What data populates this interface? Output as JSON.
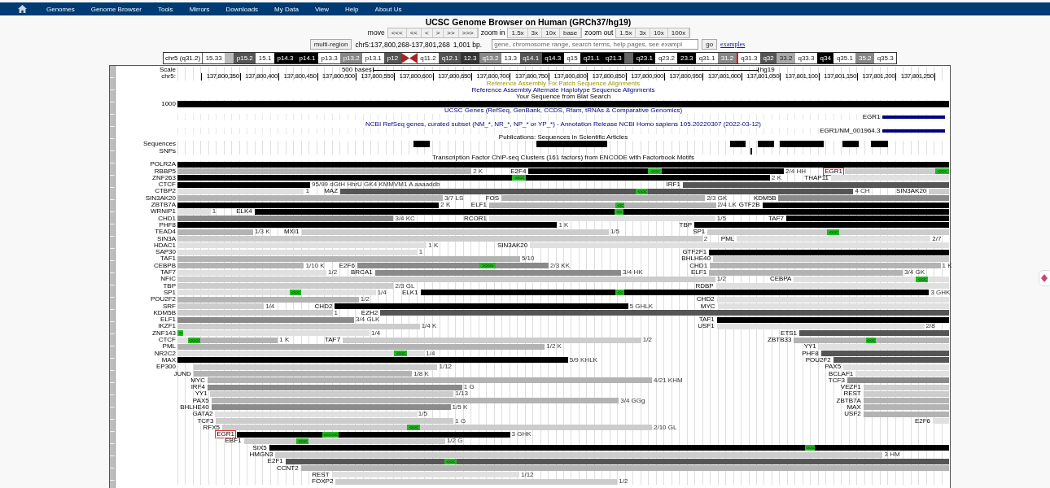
{
  "nav": {
    "items": [
      "Genomes",
      "Genome Browser",
      "Tools",
      "Mirrors",
      "Downloads",
      "My Data",
      "View",
      "Help",
      "About Us"
    ]
  },
  "title": "UCSC Genome Browser on Human (GRCh37/hg19)",
  "controls": {
    "move_label": "move",
    "move_buttons": [
      "<<<",
      "<<",
      "<",
      ">",
      ">>",
      ">>>"
    ],
    "zoom_in_label": "zoom in",
    "zoom_in_buttons": [
      "1.5x",
      "3x",
      "10x",
      "base"
    ],
    "zoom_out_label": "zoom out",
    "zoom_out_buttons": [
      "1.5x",
      "3x",
      "10x",
      "100x"
    ]
  },
  "position": {
    "multi_region": "multi-region",
    "range": "chr5:137,800,268-137,801,268",
    "size": "1,001 bp.",
    "placeholder": "gene, chromosome range, search terms, help pages, see exampl",
    "go": "go",
    "examples": "examples"
  },
  "ideogram": {
    "label": "chr5 (q31.2)",
    "bands": [
      {
        "kind": "band",
        "label": "15.33",
        "color": "#ffffff"
      },
      {
        "kind": "band",
        "color": "#bbbbbb"
      },
      {
        "kind": "band",
        "label": "p15.2",
        "color": "#555555"
      },
      {
        "kind": "band",
        "label": "15.1",
        "color": "#ffffff"
      },
      {
        "kind": "band",
        "label": "p14.3",
        "color": "#000000"
      },
      {
        "kind": "band",
        "label": "p14.1",
        "color": "#000000"
      },
      {
        "kind": "band",
        "label": "p13.3",
        "color": "#ffffff"
      },
      {
        "kind": "band",
        "label": "p13.2",
        "color": "#888888"
      },
      {
        "kind": "band",
        "label": "p13.1",
        "color": "#ffffff"
      },
      {
        "kind": "band",
        "label": "p12",
        "color": "#555555"
      },
      {
        "kind": "centromere",
        "color": "#aa2222"
      },
      {
        "kind": "band",
        "label": "q11.2",
        "color": "#ffffff"
      },
      {
        "kind": "band",
        "label": "q12.1",
        "color": "#555555"
      },
      {
        "kind": "band",
        "label": "12.3",
        "color": "#333333"
      },
      {
        "kind": "band",
        "label": "q13.2",
        "color": "#888888"
      },
      {
        "kind": "band",
        "label": "13.3",
        "color": "#ffffff"
      },
      {
        "kind": "band",
        "label": "q14.1",
        "color": "#555555"
      },
      {
        "kind": "band",
        "label": "q14.3",
        "color": "#000000"
      },
      {
        "kind": "band",
        "label": "q15",
        "color": "#ffffff"
      },
      {
        "kind": "band",
        "label": "q21.1",
        "color": "#000000"
      },
      {
        "kind": "band",
        "label": "q21.3",
        "color": "#000000"
      },
      {
        "kind": "band",
        "color": "#666666"
      },
      {
        "kind": "band",
        "label": "q23.1",
        "color": "#000000"
      },
      {
        "kind": "band",
        "label": "q23.2",
        "color": "#ffffff"
      },
      {
        "kind": "band",
        "label": "23.3",
        "color": "#000000"
      },
      {
        "kind": "band",
        "label": "q31.1",
        "color": "#ffffff"
      },
      {
        "kind": "band",
        "label": "31.2",
        "color": "#888888"
      },
      {
        "kind": "marker",
        "color": "#ee0000"
      },
      {
        "kind": "band",
        "label": "q31.3",
        "color": "#ffffff"
      },
      {
        "kind": "band",
        "label": "q32",
        "color": "#555555"
      },
      {
        "kind": "band",
        "label": "33.2",
        "color": "#aaaaaa"
      },
      {
        "kind": "band",
        "label": "q33.3",
        "color": "#ffffff"
      },
      {
        "kind": "band",
        "label": "q34",
        "color": "#000000"
      },
      {
        "kind": "band",
        "label": "q35.1",
        "color": "#ffffff"
      },
      {
        "kind": "band",
        "label": "35.2",
        "color": "#888888"
      },
      {
        "kind": "band",
        "label": "q35.3",
        "color": "#ffffff"
      }
    ]
  },
  "tracks": [
    {
      "kind": "scale",
      "label": "Scale",
      "scale_text": "500 bases",
      "assembly": "hg19"
    },
    {
      "kind": "ruler",
      "label": "chr5:",
      "ticks": [
        "137,800,350",
        "137,800,400",
        "137,800,450",
        "137,800,500",
        "137,800,550",
        "137,800,600",
        "137,800,650",
        "137,800,700",
        "137,800,750",
        "137,800,800",
        "137,800,850",
        "137,800,900",
        "137,800,950",
        "137,801,000",
        "137,801,050",
        "137,801,100",
        "137,801,150",
        "137,801,200",
        "137,801,250"
      ]
    },
    {
      "kind": "olivetitle",
      "text": "Reference Assembly Fix Patch Sequence Alignments"
    },
    {
      "kind": "navytitle",
      "text": "Reference Assembly Alternate Haplotype Sequence Alignments"
    },
    {
      "kind": "title",
      "text": "Your Sequence from Blat Search"
    },
    {
      "kind": "blocks",
      "label": "1000",
      "segments": [
        {
          "kind": "bar",
          "color": "#000000"
        }
      ]
    },
    {
      "kind": "navytitle",
      "text": "UCSC Genes (RefSeq, GenBank, CCDS, Rfam, tRNAs & Comparative Genomics)"
    },
    {
      "kind": "gene",
      "segments": [
        {
          "kind": "gap"
        },
        {
          "kind": "gene",
          "color": "#000080",
          "name": "EGR1"
        }
      ]
    },
    {
      "kind": "navytitle",
      "text": "NCBI RefSeq genes, curated subset (NM_*, NR_*, NP_* or YP_*) - Annotation Release NCBI Homo sapiens 105.20220307 (2022-03-12)"
    },
    {
      "kind": "gene",
      "segments": [
        {
          "kind": "gap"
        },
        {
          "kind": "gene",
          "color": "#000080",
          "name": "EGR1/NM_001964.3"
        }
      ]
    },
    {
      "kind": "title",
      "text": "Publications: Sequences in Scientific Articles"
    },
    {
      "kind": "blocks",
      "label": "Sequences",
      "segments": [
        {
          "kind": "gap"
        },
        {
          "kind": "bar",
          "color": "#000000"
        },
        {
          "kind": "gap"
        },
        {
          "kind": "bar",
          "color": "#000000"
        },
        {
          "kind": "gap"
        },
        {
          "kind": "bar",
          "color": "#000000"
        },
        {
          "kind": "gap"
        },
        {
          "kind": "bar",
          "color": "#000000"
        },
        {
          "kind": "gap"
        },
        {
          "kind": "bar",
          "color": "#000000"
        },
        {
          "kind": "gap"
        },
        {
          "kind": "bar",
          "color": "#000000"
        },
        {
          "kind": "gap"
        },
        {
          "kind": "bar",
          "color": "#000000"
        }
      ]
    },
    {
      "kind": "blocks",
      "label": "SNPs",
      "segments": [
        {
          "kind": "gap"
        },
        {
          "kind": "bar",
          "color": "#000000"
        }
      ]
    },
    {
      "kind": "title",
      "text": "Transcription Factor ChIP-seq Clusters (161 factors) from ENCODE with Factorbook Motifs"
    },
    {
      "kind": "tf",
      "label": "POLR2A",
      "segments": [
        {
          "kind": "bar",
          "color": "#000000"
        }
      ]
    },
    {
      "kind": "tf",
      "label": "RBBP5",
      "segments": [
        {
          "kind": "bar",
          "color": "#b3b3b3",
          "score": "2 K"
        },
        {
          "kind": "gap"
        },
        {
          "kind": "bar",
          "color": "#000000",
          "name": "E2F4"
        },
        {
          "kind": "motif",
          "text": "<<<"
        },
        {
          "kind": "bar",
          "color": "#000000",
          "score": "2/4 HH"
        },
        {
          "kind": "gap"
        },
        {
          "kind": "bar",
          "color": "#cccccc",
          "name": "EGR1",
          "boxed": true
        },
        {
          "kind": "motif",
          "text": "<<<"
        }
      ]
    },
    {
      "kind": "tf",
      "label": "ZNF263",
      "segments": [
        {
          "kind": "bar",
          "color": "#000000"
        },
        {
          "kind": "motif",
          "text": "<<<"
        },
        {
          "kind": "bar",
          "color": "#000000",
          "score": "2 K"
        },
        {
          "kind": "gap"
        },
        {
          "kind": "bar",
          "color": "#e0e0e0",
          "name": "THAP11"
        }
      ]
    },
    {
      "kind": "tf",
      "label": "CTCF",
      "segments": [
        {
          "kind": "bar",
          "color": "#000000",
          "score": "95/99 dGtH HhrU GK4 KMMVM1 A aaaaddb"
        },
        {
          "kind": "gap"
        },
        {
          "kind": "bar",
          "color": "#555555",
          "name": "IRF1"
        }
      ]
    },
    {
      "kind": "tf",
      "label": "CTBP2",
      "segments": [
        {
          "kind": "bar",
          "color": "#e0e0e0",
          "score": "1"
        },
        {
          "kind": "gap"
        },
        {
          "kind": "bar",
          "color": "#555555",
          "name": "MAZ"
        },
        {
          "kind": "motif",
          "text": "<<<"
        },
        {
          "kind": "bar",
          "color": "#555555",
          "score": "4 CH"
        },
        {
          "kind": "gap"
        },
        {
          "kind": "bar",
          "color": "#cccccc",
          "name": "SIN3AK20"
        }
      ]
    },
    {
      "kind": "tf",
      "label": "SIN3AK20",
      "segments": [
        {
          "kind": "bar",
          "color": "#b3b3b3",
          "score": "3/7 LS"
        },
        {
          "kind": "gap"
        },
        {
          "kind": "bar",
          "color": "#b3b3b3",
          "name": "FOS",
          "score": "2/3 GK"
        },
        {
          "kind": "gap"
        },
        {
          "kind": "bar",
          "color": "#8a8a8a",
          "name": "KDM5B"
        }
      ]
    },
    {
      "kind": "tf",
      "label": "ZBTB7A",
      "segments": [
        {
          "kind": "bar",
          "color": "#000000",
          "score": "2 K"
        },
        {
          "kind": "gap"
        },
        {
          "kind": "bar",
          "color": "#b3b3b3",
          "name": "ELF1"
        },
        {
          "kind": "motif",
          "text": "<<"
        },
        {
          "kind": "bar",
          "color": "#b3b3b3",
          "score": "2/4 LK"
        },
        {
          "kind": "gap"
        },
        {
          "kind": "bar",
          "color": "#000000",
          "name": "GTF2B"
        }
      ]
    },
    {
      "kind": "tf",
      "label": "WRNIP1",
      "segments": [
        {
          "kind": "bar",
          "color": "#e0e0e0",
          "score": "1"
        },
        {
          "kind": "gap"
        },
        {
          "kind": "bar",
          "color": "#000000",
          "name": "ELK4"
        },
        {
          "kind": "motif",
          "text": "<<"
        },
        {
          "kind": "bar",
          "color": "#000000"
        }
      ]
    },
    {
      "kind": "tf",
      "label": "CHD1",
      "segments": [
        {
          "kind": "bar",
          "color": "#8a8a8a",
          "score": "3/4 KC"
        },
        {
          "kind": "gap"
        },
        {
          "kind": "bar",
          "color": "#e0e0e0",
          "name": "RCOR1",
          "score": "1/5"
        },
        {
          "kind": "gap"
        },
        {
          "kind": "bar",
          "color": "#000000",
          "name": "TAF7"
        }
      ]
    },
    {
      "kind": "tf",
      "label": "PHF8",
      "segments": [
        {
          "kind": "bar",
          "color": "#000000",
          "score": "1 K"
        },
        {
          "kind": "gap"
        },
        {
          "kind": "bar",
          "color": "#000000",
          "name": "TBP"
        }
      ]
    },
    {
      "kind": "tf",
      "label": "TEAD4",
      "segments": [
        {
          "kind": "bar",
          "color": "#b3b3b3",
          "score": "1/3 K"
        },
        {
          "kind": "gap"
        },
        {
          "kind": "bar",
          "color": "#cccccc",
          "name": "MXI1",
          "score": "1/5"
        },
        {
          "kind": "gap"
        },
        {
          "kind": "bar",
          "color": "#cccccc",
          "name": "SP1"
        },
        {
          "kind": "motif",
          "text": "<<<"
        },
        {
          "kind": "bar",
          "color": "#cccccc"
        }
      ]
    },
    {
      "kind": "tf",
      "label": "SIN3A",
      "segments": [
        {
          "kind": "bar",
          "color": "#cccccc",
          "score": "2"
        },
        {
          "kind": "gap"
        },
        {
          "kind": "bar",
          "color": "#e0e0e0",
          "name": "PML",
          "score": "2/7"
        },
        {
          "kind": "gap"
        }
      ]
    },
    {
      "kind": "tf",
      "label": "HDAC1",
      "segments": [
        {
          "kind": "bar",
          "color": "#e0e0e0",
          "score": "1 K"
        },
        {
          "kind": "gap"
        },
        {
          "kind": "bar",
          "color": "#e0e0e0",
          "name": "SIN3AK20"
        }
      ]
    },
    {
      "kind": "tf",
      "label": "SAP30",
      "segments": [
        {
          "kind": "bar",
          "color": "#e0e0e0",
          "score": "1"
        },
        {
          "kind": "gap"
        },
        {
          "kind": "bar",
          "color": "#000000",
          "name": "GTF2F1"
        }
      ]
    },
    {
      "kind": "tf",
      "label": "TAF1",
      "segments": [
        {
          "kind": "bar",
          "color": "#b3b3b3",
          "score": "5/10"
        },
        {
          "kind": "gap"
        },
        {
          "kind": "bar",
          "color": "#cccccc",
          "name": "BHLHE40"
        }
      ]
    },
    {
      "kind": "tf",
      "label": "CEBPB",
      "segments": [
        {
          "kind": "bar",
          "color": "#b3b3b3",
          "score": "1/10 K"
        },
        {
          "kind": "gap"
        },
        {
          "kind": "bar",
          "color": "#8a8a8a",
          "name": "E2F6"
        },
        {
          "kind": "motif",
          "text": ">>>>"
        },
        {
          "kind": "bar",
          "color": "#8a8a8a",
          "score": "2/3 KK"
        },
        {
          "kind": "gap"
        },
        {
          "kind": "bar",
          "color": "#b3b3b3",
          "name": "CHD1",
          "score": "1 K"
        },
        {
          "kind": "gap"
        }
      ]
    },
    {
      "kind": "tf",
      "label": "TAF7",
      "segments": [
        {
          "kind": "bar",
          "color": "#e0e0e0",
          "score": "1/2"
        },
        {
          "kind": "gap"
        },
        {
          "kind": "bar",
          "color": "#8a8a8a",
          "name": "BRCA1",
          "score": "3/4 HK"
        },
        {
          "kind": "gap"
        },
        {
          "kind": "bar",
          "color": "#b3b3b3",
          "name": "ELF1",
          "score": "3/4 GK"
        },
        {
          "kind": "gap"
        }
      ]
    },
    {
      "kind": "tf",
      "label": "NFIC",
      "segments": [
        {
          "kind": "bar",
          "color": "#cccccc",
          "score": "1/2"
        },
        {
          "kind": "gap"
        },
        {
          "kind": "bar",
          "color": "#e0e0e0",
          "name": "CEBPA"
        },
        {
          "kind": "motif",
          "text": "<<<"
        },
        {
          "kind": "bar",
          "color": "#e0e0e0"
        }
      ]
    },
    {
      "kind": "tf",
      "label": "TBP",
      "segments": [
        {
          "kind": "bar",
          "color": "#cccccc",
          "score": "2/3 GL"
        },
        {
          "kind": "gap"
        },
        {
          "kind": "bar",
          "color": "#e0e0e0",
          "name": "RDBP"
        }
      ]
    },
    {
      "kind": "tf",
      "label": "SP1",
      "segments": [
        {
          "kind": "bar",
          "color": "#e0e0e0"
        },
        {
          "kind": "motif",
          "text": "<<<"
        },
        {
          "kind": "bar",
          "color": "#e0e0e0",
          "score": "1/4"
        },
        {
          "kind": "gap"
        },
        {
          "kind": "bar",
          "color": "#000000",
          "name": "ELK1"
        },
        {
          "kind": "motif",
          "text": "<<"
        },
        {
          "kind": "bar",
          "color": "#000000",
          "score": "3 GHK"
        },
        {
          "kind": "gap"
        }
      ]
    },
    {
      "kind": "tf",
      "label": "POU2F2",
      "segments": [
        {
          "kind": "bar",
          "color": "#b3b3b3",
          "score": "1/2"
        },
        {
          "kind": "gap"
        },
        {
          "kind": "bar",
          "color": "#e0e0e0",
          "name": "CHD2"
        }
      ]
    },
    {
      "kind": "tf",
      "label": "SRF",
      "segments": [
        {
          "kind": "bar",
          "color": "#cccccc",
          "score": "1/4"
        },
        {
          "kind": "gap"
        },
        {
          "kind": "bar",
          "color": "#000000",
          "name": "CHD2",
          "score": "5 GHLK"
        },
        {
          "kind": "gap"
        },
        {
          "kind": "bar",
          "color": "#e0e0e0",
          "name": "MYC"
        }
      ]
    },
    {
      "kind": "tf",
      "label": "KDM5B",
      "segments": [
        {
          "kind": "bar",
          "color": "#cccccc",
          "score": "1"
        },
        {
          "kind": "gap"
        },
        {
          "kind": "bar",
          "color": "#555555",
          "name": "EZH2"
        }
      ]
    },
    {
      "kind": "tf",
      "label": "ELF1",
      "segments": [
        {
          "kind": "bar",
          "color": "#8a8a8a",
          "score": "3/4 GLK"
        },
        {
          "kind": "gap"
        },
        {
          "kind": "bar",
          "color": "#000000",
          "name": "TAF1"
        }
      ]
    },
    {
      "kind": "tf",
      "label": "IKZF1",
      "segments": [
        {
          "kind": "bar",
          "color": "#cccccc",
          "score": "1/4 K"
        },
        {
          "kind": "gap"
        },
        {
          "kind": "bar",
          "color": "#e0e0e0",
          "name": "USF1",
          "score": "2/8"
        },
        {
          "kind": "gap"
        }
      ]
    },
    {
      "kind": "tf",
      "label": "ZNF143",
      "segments": [
        {
          "kind": "motif",
          "text": ">"
        },
        {
          "kind": "bar",
          "color": "#e0e0e0",
          "score": "1/4"
        },
        {
          "kind": "gap"
        },
        {
          "kind": "bar",
          "color": "#555555",
          "name": "ETS1"
        }
      ]
    },
    {
      "kind": "tf",
      "label": "CTCF",
      "segments": [
        {
          "kind": "bar",
          "color": "#e0e0e0"
        },
        {
          "kind": "motif",
          "text": "<<<<"
        },
        {
          "kind": "bar",
          "color": "#b3b3b3",
          "score": "1 K"
        },
        {
          "kind": "gap"
        },
        {
          "kind": "bar",
          "color": "#cccccc",
          "name": "TAF7",
          "score": "1/2"
        },
        {
          "kind": "gap"
        },
        {
          "kind": "bar",
          "color": "#b3b3b3",
          "name": "ZBTB33"
        },
        {
          "kind": "motif",
          "text": "<<<"
        },
        {
          "kind": "bar",
          "color": "#b3b3b3"
        }
      ]
    },
    {
      "kind": "tf",
      "label": "PML",
      "segments": [
        {
          "kind": "bar",
          "color": "#b3b3b3",
          "score": "1/2 K"
        },
        {
          "kind": "gap"
        },
        {
          "kind": "bar",
          "color": "#e0e0e0",
          "name": "YY1"
        }
      ]
    },
    {
      "kind": "tf",
      "label": "NR2C2",
      "segments": [
        {
          "kind": "bar",
          "color": "#e0e0e0"
        },
        {
          "kind": "motif",
          "text": "<<<"
        },
        {
          "kind": "bar",
          "color": "#e0e0e0",
          "score": "1/4"
        },
        {
          "kind": "gap"
        },
        {
          "kind": "bar",
          "color": "#555555",
          "name": "PHF8"
        }
      ]
    },
    {
      "kind": "tf",
      "label": "MAX",
      "segments": [
        {
          "kind": "bar",
          "color": "#000000",
          "score": "5/9 KHLK"
        },
        {
          "kind": "gap"
        },
        {
          "kind": "bar",
          "color": "#555555",
          "name": "POU2F2"
        }
      ]
    },
    {
      "kind": "tf",
      "label": "EP300",
      "segments": [
        {
          "kind": "gap"
        },
        {
          "kind": "bar",
          "color": "#cccccc",
          "score": "1/12"
        },
        {
          "kind": "gap"
        },
        {
          "kind": "bar",
          "color": "#e0e0e0",
          "name": "PAX5"
        }
      ]
    },
    {
      "kind": "tf",
      "segments": [
        {
          "kind": "gap"
        },
        {
          "kind": "bar",
          "color": "#b3b3b3",
          "name": "JUND",
          "score": "1/8 K"
        },
        {
          "kind": "gap"
        },
        {
          "kind": "bar",
          "color": "#e0e0e0",
          "name": "BCLAF1"
        }
      ]
    },
    {
      "kind": "tf",
      "segments": [
        {
          "kind": "gap"
        },
        {
          "kind": "bar",
          "color": "#b3b3b3",
          "name": "MYC",
          "score": "4/21 KHM"
        },
        {
          "kind": "gap"
        },
        {
          "kind": "bar",
          "color": "#8a8a8a",
          "name": "TCF3"
        }
      ]
    },
    {
      "kind": "tf",
      "segments": [
        {
          "kind": "gap"
        },
        {
          "kind": "bar",
          "color": "#8a8a8a",
          "name": "IRF4",
          "score": "1 G"
        },
        {
          "kind": "gap"
        },
        {
          "kind": "bar",
          "color": "#cccccc",
          "name": "VEZF1"
        }
      ]
    },
    {
      "kind": "tf",
      "segments": [
        {
          "kind": "gap"
        },
        {
          "kind": "bar",
          "color": "#cccccc",
          "name": "YY1",
          "score": "1/13"
        },
        {
          "kind": "gap"
        },
        {
          "kind": "bar",
          "color": "#cccccc",
          "name": "REST"
        }
      ]
    },
    {
      "kind": "tf",
      "segments": [
        {
          "kind": "gap"
        },
        {
          "kind": "bar",
          "color": "#b3b3b3",
          "name": "PAX5",
          "score": "3/4 GGg"
        },
        {
          "kind": "gap"
        },
        {
          "kind": "bar",
          "color": "#b3b3b3",
          "name": "ZBTB7A"
        }
      ]
    },
    {
      "kind": "tf",
      "segments": [
        {
          "kind": "gap"
        },
        {
          "kind": "bar",
          "color": "#8a8a8a",
          "name": "BHLHE40",
          "score": "1/5 K"
        },
        {
          "kind": "gap"
        },
        {
          "kind": "bar",
          "color": "#b3b3b3",
          "name": "MAX"
        }
      ]
    },
    {
      "kind": "tf",
      "segments": [
        {
          "kind": "gap"
        },
        {
          "kind": "bar",
          "color": "#e0e0e0",
          "name": "GATA2",
          "score": "1/5"
        },
        {
          "kind": "gap"
        },
        {
          "kind": "bar",
          "color": "#b3b3b3",
          "name": "USF2"
        }
      ]
    },
    {
      "kind": "tf",
      "segments": [
        {
          "kind": "gap"
        },
        {
          "kind": "bar",
          "color": "#cccccc",
          "name": "TCF3",
          "score": "1 G"
        },
        {
          "kind": "gap"
        },
        {
          "kind": "bar",
          "color": "#e0e0e0",
          "name": "E2F6"
        }
      ]
    },
    {
      "kind": "tf",
      "segments": [
        {
          "kind": "gap"
        },
        {
          "kind": "bar",
          "color": "#cccccc",
          "name": "RFX5"
        },
        {
          "kind": "motif",
          "text": "<<<"
        },
        {
          "kind": "bar",
          "color": "#cccccc",
          "score": "2/10 GL"
        },
        {
          "kind": "gap"
        }
      ]
    },
    {
      "kind": "tf",
      "segments": [
        {
          "kind": "gap"
        },
        {
          "kind": "bar",
          "color": "#000000",
          "name": "EGR1",
          "boxed": true
        },
        {
          "kind": "motif",
          "text": "<<<<<"
        },
        {
          "kind": "bar",
          "color": "#000000",
          "score": "3 GHK"
        },
        {
          "kind": "gap"
        }
      ]
    },
    {
      "kind": "tf",
      "segments": [
        {
          "kind": "gap"
        },
        {
          "kind": "bar",
          "color": "#cccccc",
          "name": "EBF1"
        },
        {
          "kind": "motif",
          "text": "<<<"
        },
        {
          "kind": "bar",
          "color": "#cccccc",
          "score": "1/2 G"
        },
        {
          "kind": "gap"
        }
      ]
    },
    {
      "kind": "tf",
      "segments": [
        {
          "kind": "gap"
        },
        {
          "kind": "bar",
          "color": "#000000",
          "name": "SIX5"
        },
        {
          "kind": "motif",
          "text": "<<<"
        },
        {
          "kind": "bar",
          "color": "#000000"
        }
      ]
    },
    {
      "kind": "tf",
      "segments": [
        {
          "kind": "gap"
        },
        {
          "kind": "bar",
          "color": "#cccccc",
          "name": "HMGN3",
          "score": "3 HM"
        },
        {
          "kind": "gap"
        }
      ]
    },
    {
      "kind": "tf",
      "segments": [
        {
          "kind": "gap"
        },
        {
          "kind": "bar",
          "color": "#555555",
          "name": "E2F1"
        },
        {
          "kind": "motif",
          "text": "<<<"
        },
        {
          "kind": "bar",
          "color": "#555555"
        }
      ]
    },
    {
      "kind": "tf",
      "segments": [
        {
          "kind": "gap"
        },
        {
          "kind": "bar",
          "color": "#b3b3b3",
          "name": "CCNT2"
        }
      ]
    },
    {
      "kind": "tf",
      "segments": [
        {
          "kind": "gap"
        },
        {
          "kind": "bar",
          "color": "#e0e0e0",
          "name": "REST",
          "score": "1/12"
        },
        {
          "kind": "gap"
        }
      ]
    },
    {
      "kind": "tf",
      "segments": [
        {
          "kind": "gap"
        },
        {
          "kind": "bar",
          "color": "#cccccc",
          "name": "FOXP2",
          "score": "1/2"
        },
        {
          "kind": "gap"
        }
      ]
    }
  ]
}
